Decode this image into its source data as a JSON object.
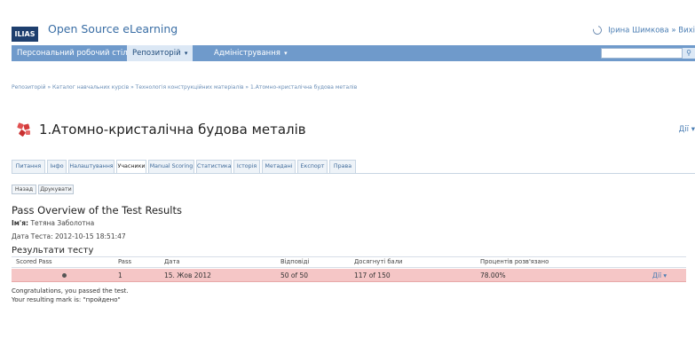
{
  "header": {
    "logo_text": "ILIAS",
    "site_title": "Open Source eLearning",
    "user_text": "Ірина Шимкова » Вихі"
  },
  "menu": {
    "items": [
      {
        "label": "Персональний робочий стіл"
      },
      {
        "label": "Репозиторій"
      },
      {
        "label": "Адміністрування"
      }
    ],
    "search_placeholder": "",
    "search_icon": "search-icon"
  },
  "breadcrumb": "Репозиторій » Каталог навчальних курсів » Технологія конструкційних матеріалів » 1.Атомно-кристалічна будова металів",
  "page": {
    "title": "1.Атомно-кристалічна будова металів",
    "actions_label": "Дії"
  },
  "tabs": [
    {
      "label": "Питання"
    },
    {
      "label": "Інфо"
    },
    {
      "label": "Налаштування"
    },
    {
      "label": "Учасники"
    },
    {
      "label": "Manual Scoring"
    },
    {
      "label": "Статистика"
    },
    {
      "label": "Історія"
    },
    {
      "label": "Метадані"
    },
    {
      "label": "Експорт"
    },
    {
      "label": "Права"
    }
  ],
  "toolbar": {
    "back_label": "Назад",
    "print_label": "Друкувати"
  },
  "content": {
    "heading": "Pass Overview of the Test Results",
    "name_label": "Ім'я:",
    "name_value": "Тетяна Заболотна",
    "date_label": "Дата Теста:",
    "date_value": "2012-10-15 18:51:47",
    "results_heading": "Результати тесту"
  },
  "table": {
    "columns": [
      "Scored Pass",
      "Pass",
      "Дата",
      "Відповіді",
      "Досягнуті бали",
      "Процентів розв'язано"
    ],
    "rows": [
      {
        "pass": "1",
        "date": "15. Жов 2012",
        "answers": "50 of 50",
        "points": "117 of 150",
        "percent": "78.00%",
        "actions": "Дії"
      }
    ]
  },
  "messages": {
    "congrats": "Congratulations, you passed the test.",
    "mark": "Your resulting mark is: \"пройдено\""
  },
  "colors": {
    "menu_bar": "#6f9acb",
    "row_highlight": "#f5c6c6",
    "link": "#4a7db3"
  }
}
